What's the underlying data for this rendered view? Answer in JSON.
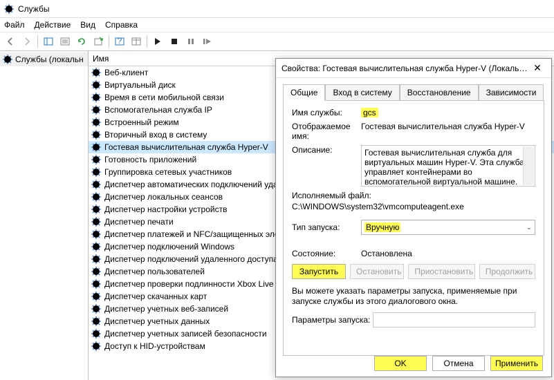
{
  "window": {
    "title": "Службы"
  },
  "menu": {
    "file": "Файл",
    "action": "Действие",
    "view": "Вид",
    "help": "Справка"
  },
  "left": {
    "root": "Службы (локальн"
  },
  "list": {
    "header": "Имя",
    "items": [
      "Веб-клиент",
      "Виртуальный диск",
      "Время в сети мобильной связи",
      "Вспомогательная служба IP",
      "Встроенный режим",
      "Вторичный вход в систему",
      "Гостевая вычислительная служба Hyper-V",
      "Готовность приложений",
      "Группировка сетевых участников",
      "Диспетчер автоматических подключений уда",
      "Диспетчер локальных сеансов",
      "Диспетчер настройки устройств",
      "Диспетчер печати",
      "Диспетчер платежей и NFC/защищенных эле",
      "Диспетчер подключений Windows",
      "Диспетчер подключений удаленного доступа",
      "Диспетчер пользователей",
      "Диспетчер проверки подлинности Xbox Live",
      "Диспетчер скачанных карт",
      "Диспетчер учетных веб-записей",
      "Диспетчер учетных данных",
      "Диспетчер учетных записей безопасности",
      "Доступ к HID-устройствам"
    ],
    "selected_index": 6
  },
  "dialog": {
    "title": "Свойства: Гостевая вычислительная служба Hyper-V (Локальны…",
    "tabs": {
      "general": "Общие",
      "logon": "Вход в систему",
      "recovery": "Восстановление",
      "deps": "Зависимости"
    },
    "labels": {
      "service_name": "Имя службы:",
      "display_name": "Отображаемое имя:",
      "description": "Описание:",
      "exe": "Исполняемый файл:",
      "startup": "Тип запуска:",
      "state": "Состояние:",
      "params": "Параметры запуска:",
      "hint": "Вы можете указать параметры запуска, применяемые при запуске службы из этого диалогового окна."
    },
    "values": {
      "service_name": "gcs",
      "display_name": "Гостевая вычислительная служба Hyper-V",
      "description": "Гостевая вычислительная служба для виртуальных машин Hyper-V. Эта служба управляет контейнерами во вспомогательной виртуальной машине.",
      "exe": "C:\\WINDOWS\\system32\\vmcomputeagent.exe",
      "startup": "Вручную",
      "state": "Остановлена",
      "params": ""
    },
    "buttons": {
      "start": "Запустить",
      "stop": "Остановить",
      "pause": "Приостановить",
      "resume": "Продолжить",
      "ok": "OK",
      "cancel": "Отмена",
      "apply": "Применить"
    }
  }
}
